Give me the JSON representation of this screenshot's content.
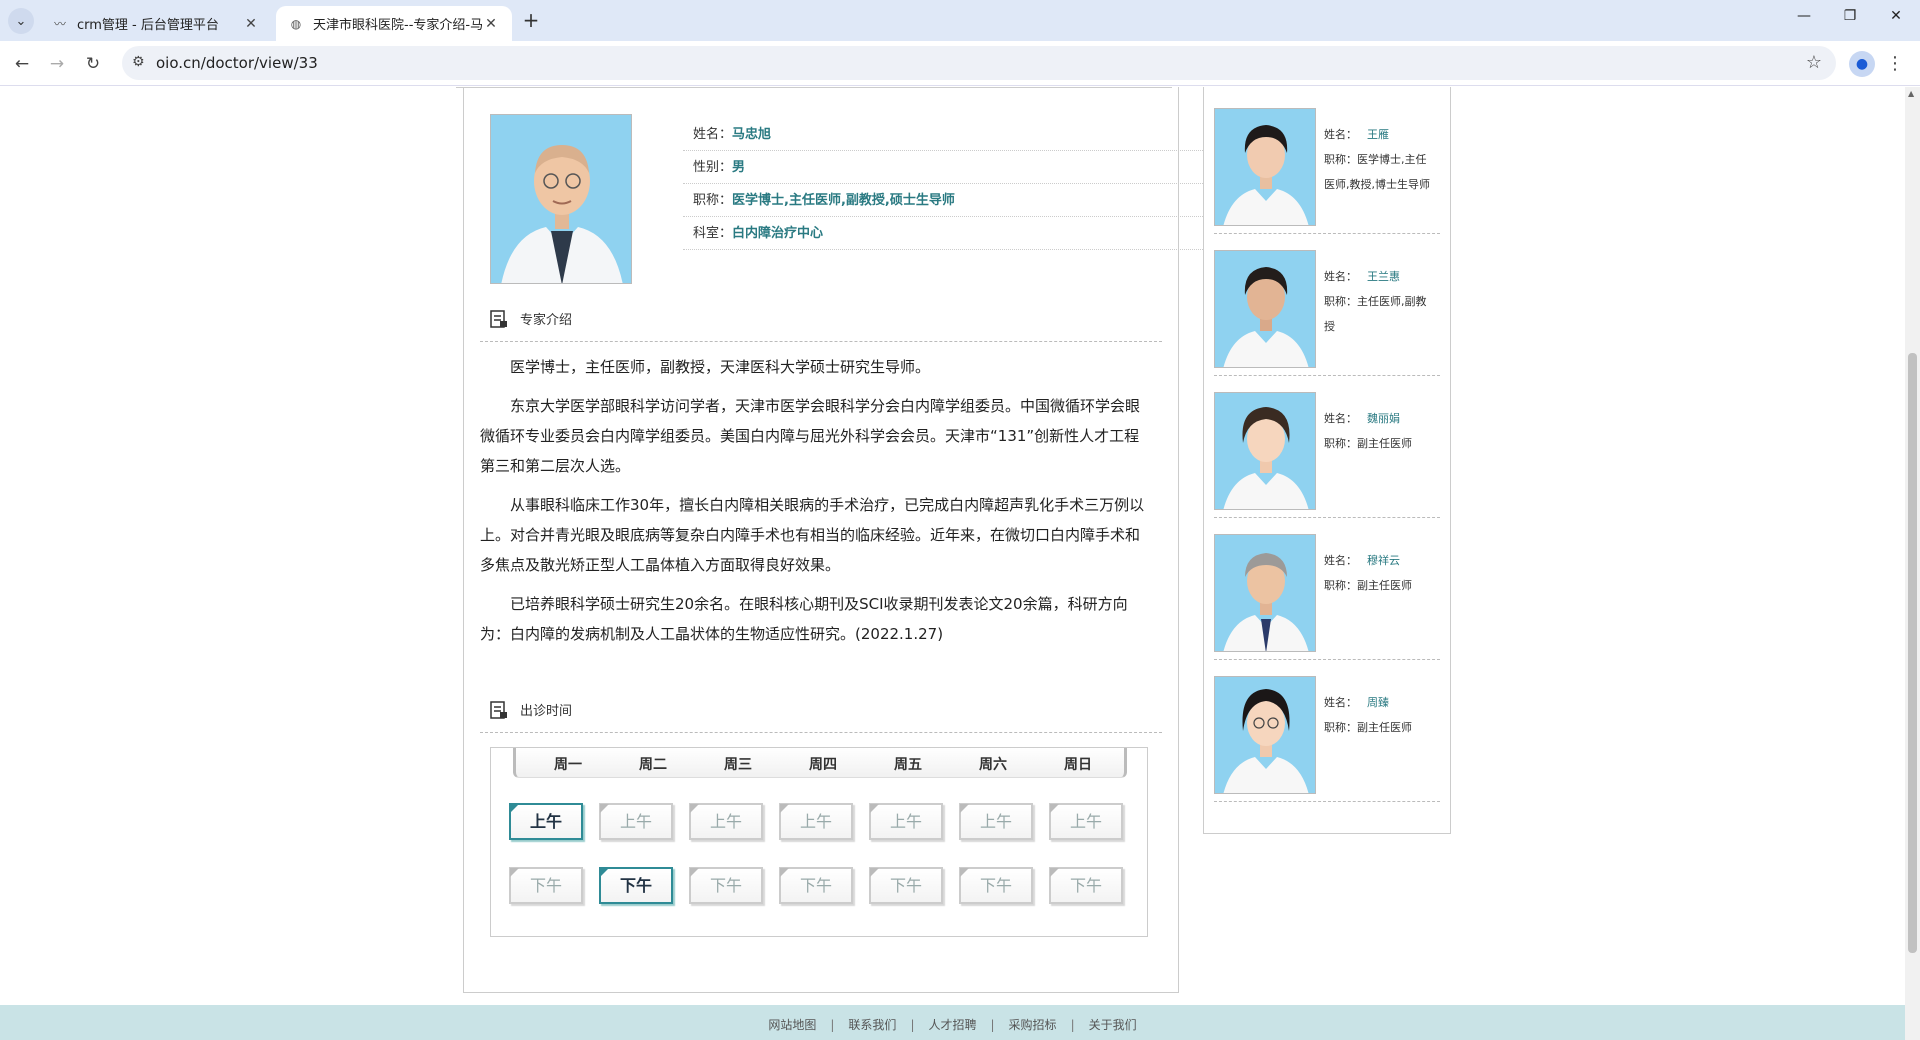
{
  "browser": {
    "tabs": [
      {
        "title": "crm管理 - 后台管理平台",
        "active": false
      },
      {
        "title": "天津市眼科医院--专家介绍-马忠旭",
        "active": true
      }
    ],
    "url": "oio.cn/doctor/view/33"
  },
  "doctor": {
    "labels": {
      "name": "姓名：",
      "gender": "性别：",
      "title": "职称：",
      "dept": "科室："
    },
    "name": "马忠旭",
    "gender": "男",
    "title": "医学博士,主任医师,副教授,硕士生导师",
    "dept": "白内障治疗中心"
  },
  "intro_heading": "专家介绍",
  "intro_paragraphs": [
    "医学博士，主任医师，副教授，天津医科大学硕士研究生导师。",
    "东京大学医学部眼科学访问学者，天津市医学会眼科学分会白内障学组委员。中国微循环学会眼微循环专业委员会白内障学组委员。美国白内障与屈光外科学会会员。天津市“131”创新性人才工程第三和第二层次人选。",
    "从事眼科临床工作30年，擅长白内障相关眼病的手术治疗，已完成白内障超声乳化手术三万例以上。对合并青光眼及眼底病等复杂白内障手术也有相当的临床经验。近年来，在微切口白内障手术和多焦点及散光矫正型人工晶体植入方面取得良好效果。",
    "已培养眼科学硕士研究生20余名。在眼科核心期刊及SCI收录期刊发表论文20余篇，科研方向为：白内障的发病机制及人工晶状体的生物适应性研究。(2022.1.27)"
  ],
  "schedule_heading": "出诊时间",
  "schedule": {
    "days": [
      "周一",
      "周二",
      "周三",
      "周四",
      "周五",
      "周六",
      "周日"
    ],
    "am_label": "上午",
    "pm_label": "下午",
    "am_active": [
      true,
      false,
      false,
      false,
      false,
      false,
      false
    ],
    "pm_active": [
      false,
      true,
      false,
      false,
      false,
      false,
      false
    ]
  },
  "sidebar": {
    "name_label": "姓名：",
    "title_label": "职称：",
    "doctors": [
      {
        "name": "王雁",
        "title": "医学博士,主任医师,教授,博士生导师"
      },
      {
        "name": "王兰惠",
        "title": "主任医师,副教授"
      },
      {
        "name": "魏丽娟",
        "title": "副主任医师"
      },
      {
        "name": "穆祥云",
        "title": "副主任医师"
      },
      {
        "name": "周臻",
        "title": "副主任医师"
      }
    ]
  },
  "footer": {
    "links": [
      "网站地图",
      "联系我们",
      "人才招聘",
      "采购招标",
      "关于我们"
    ]
  },
  "colors": {
    "accent": "#2a7a82",
    "footer_bg": "#c9e3e6",
    "photo_bg": "#8fd2f0"
  }
}
